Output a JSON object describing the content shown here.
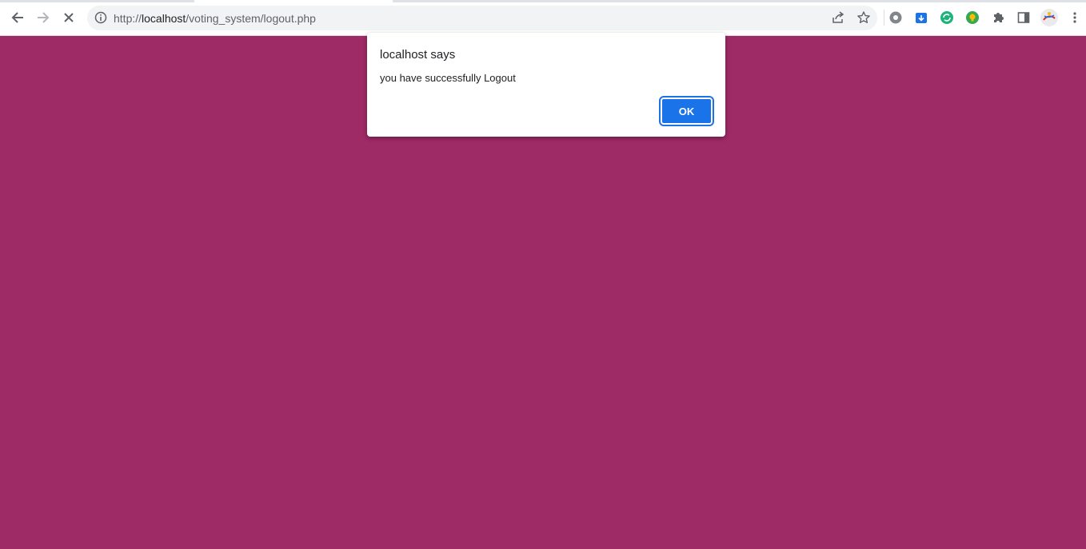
{
  "browser": {
    "url_prefix": "http://",
    "url_host": "localhost",
    "url_path": "/voting_system/logout.php"
  },
  "page": {
    "background_color": "#9e2a66"
  },
  "dialog": {
    "title": "localhost says",
    "message": "you have successfully Logout",
    "ok_label": "OK"
  },
  "toolbar_icons": [
    "back-icon",
    "forward-icon",
    "stop-icon",
    "info-icon",
    "share-icon",
    "star-icon",
    "extension-icons",
    "puzzle-icon",
    "side-panel-icon",
    "profile-avatar",
    "menu-icon"
  ]
}
